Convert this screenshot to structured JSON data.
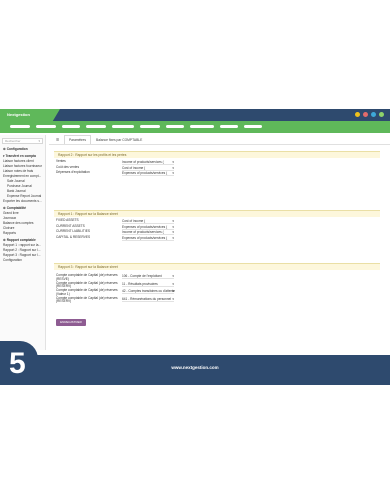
{
  "app": {
    "brand": "Nextgestion"
  },
  "colors": {
    "navy": "#2e4a6e",
    "green": "#5fb85a",
    "dots": [
      "#f0c21b",
      "#e36b6b",
      "#3ea8d8",
      "#8fd36a"
    ]
  },
  "sidebar": {
    "search_placeholder": "Rechercher",
    "items": [
      {
        "label": "⚙ Configuration",
        "kind": "head"
      },
      {
        "label": "▾ Transfert en compta",
        "kind": "head"
      },
      {
        "label": "Liaison factures client",
        "kind": "item"
      },
      {
        "label": "Liaison factures fournisseur",
        "kind": "item"
      },
      {
        "label": "Liaison notes de frais",
        "kind": "item"
      },
      {
        "label": "Enregistrement en compt...",
        "kind": "item"
      },
      {
        "label": "Sale Journal",
        "kind": "sub"
      },
      {
        "label": "Purchase Journal",
        "kind": "sub"
      },
      {
        "label": "Bank Journal",
        "kind": "sub"
      },
      {
        "label": "Expense Report Journal",
        "kind": "sub"
      },
      {
        "label": "Exporter les documents s...",
        "kind": "item"
      },
      {
        "label": "⚙ Comptabilité",
        "kind": "head"
      },
      {
        "label": "Grand livre",
        "kind": "item"
      },
      {
        "label": "Journaux",
        "kind": "item"
      },
      {
        "label": "Balance des comptes",
        "kind": "item"
      },
      {
        "label": "Clotrure",
        "kind": "item"
      },
      {
        "label": "Rapports",
        "kind": "item"
      },
      {
        "label": "⚙ Rapport comptable",
        "kind": "head"
      },
      {
        "label": "Rapport 1 : rapport sur la...",
        "kind": "item"
      },
      {
        "label": "Rapport 2 : Rapport sur l...",
        "kind": "item"
      },
      {
        "label": "Rapport 3 : Rapport sur l...",
        "kind": "item"
      },
      {
        "label": "Configuration",
        "kind": "item"
      }
    ]
  },
  "tabs": [
    {
      "label": "☰",
      "active": false
    },
    {
      "label": "Paramètres",
      "active": true
    },
    {
      "label": "Balance fixes par COMPTABLE",
      "active": false
    }
  ],
  "sections": [
    {
      "title": "Rapport 2 : Rapport sur les profits et les pertes",
      "rows": [
        {
          "label": "Ventes",
          "value": "Income of products/services ("
        },
        {
          "label": "Coût des ventes",
          "value": "Cost of income ("
        },
        {
          "label": "Dépenses d'exploitation",
          "value": "Expenses of products/services ("
        }
      ]
    },
    {
      "title": "Rapport 1 : Rapport sur la Balance sheet",
      "rows": [
        {
          "label": "FIXED ASSETS",
          "value": "Cost of income ("
        },
        {
          "label": "CURRENT ASSETS",
          "value": "Expenses of products/services ("
        },
        {
          "label": "CURRENT LIABILITIES",
          "value": "Income of products/services ("
        },
        {
          "label": "CAPITAL & RESERVES",
          "value": "Expenses of products/services ("
        }
      ]
    },
    {
      "title": "Rapport 3 : Rapport sur la Balance sheet",
      "rows": [
        {
          "label": "Compte comptable de Capital (de) réserves (RESVE)",
          "value": "106 - Compte de l'exploitant"
        },
        {
          "label": "Compte comptable de Capital (de) réserves (RESERV)",
          "value": "11 - Résultats provisoires"
        },
        {
          "label": "Compte comptable de Capital (de) réserves (Valeur 1)",
          "value": "42 - Comptes transitoires ou d'attente"
        },
        {
          "label": "Compte comptable de Capital (de) réserves (RESERV)",
          "value": "641 - Rémunérations du personnel"
        }
      ]
    }
  ],
  "save_label": "ENREGISTRER",
  "footer": {
    "url": "www.nextgestion.com",
    "step_number": "5"
  }
}
